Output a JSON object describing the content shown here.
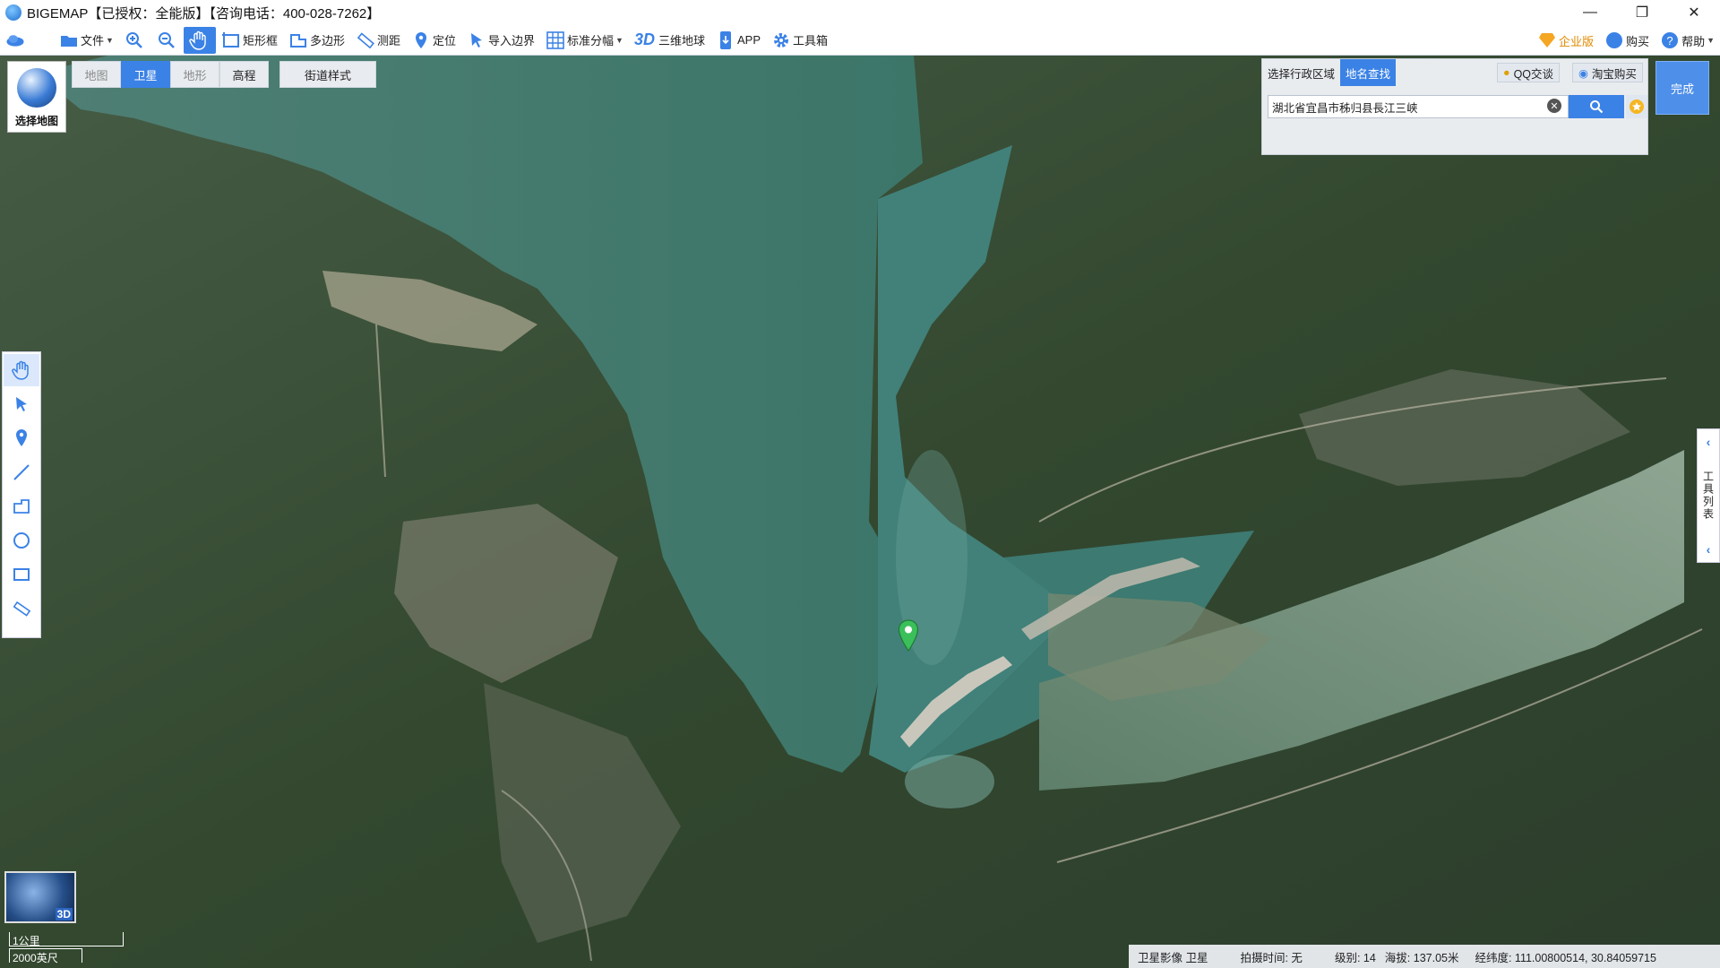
{
  "window": {
    "title": "BIGEMAP【已授权：全能版】【咨询电话：400-028-7262】",
    "controls": [
      "—",
      "❐",
      "✕"
    ]
  },
  "toolbar": {
    "file": "文件",
    "rect": "矩形框",
    "polygon": "多边形",
    "measure": "测距",
    "locate": "定位",
    "import_border": "导入边界",
    "grid": "标准分幅",
    "three_d_icon": "3D",
    "globe": "三维地球",
    "app": "APP",
    "toolbox": "工具箱",
    "enterprise": "企业版",
    "buy": "购买",
    "help": "帮助"
  },
  "maptype": {
    "label": "选择地图",
    "tabs": [
      "地图",
      "卫星",
      "地形",
      "高程"
    ],
    "active_tab": "卫星",
    "street_style": "街道样式"
  },
  "search": {
    "tab_region": "选择行政区域",
    "tab_place": "地名查找",
    "qq": "QQ交谈",
    "taobao": "淘宝购买",
    "query": "湖北省宜昌市秭归县長江三峡",
    "done": "完成"
  },
  "right_panel": {
    "label": "工具列表"
  },
  "minimap": {
    "badge": "3D"
  },
  "scale": {
    "metric": "1公里",
    "imperial": "2000英尺"
  },
  "status": {
    "layer": "卫星影像 卫星",
    "capture_time": "拍摄时间: 无",
    "level": "级别:  14",
    "altitude": "海拔: 137.05米",
    "coords": "经纬度:  111.00800514, 30.84059715"
  },
  "colors": {
    "accent": "#3b82e6",
    "water": "#3e7a6e",
    "land": "#3a4f3d"
  }
}
